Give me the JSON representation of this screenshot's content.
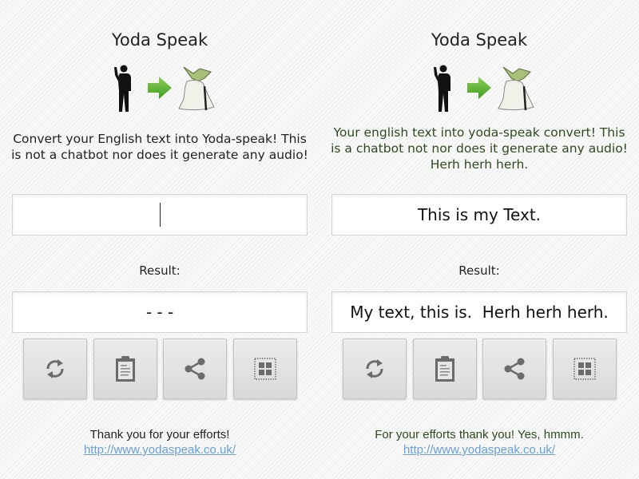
{
  "left_panel": {
    "title": "Yoda Speak",
    "description_line1": "Convert your English text into Yoda-speak! This",
    "description_line2": "is not a chatbot nor does it generate any audio!",
    "input_value": "",
    "result_label": "Result:",
    "result_value": "- - -",
    "footer_text": "Thank you for your efforts!",
    "footer_link": "http://www.yodaspeak.co.uk/"
  },
  "right_panel": {
    "title": "Yoda Speak",
    "description_line1": "Your english text into yoda-speak convert! This",
    "description_line2": "is a chatbot not nor does it generate any audio!",
    "description_line3": "Herh herh herh.",
    "input_value": "This is my Text.",
    "result_label": "Result:",
    "result_value": "My text, this is.  Herh herh herh.",
    "footer_text": "For your efforts thank you! Yes, hmmm.",
    "footer_link": "http://www.yodaspeak.co.uk/"
  },
  "buttons": [
    {
      "icon": "refresh-icon"
    },
    {
      "icon": "clipboard-icon"
    },
    {
      "icon": "share-icon"
    },
    {
      "icon": "select-all-icon"
    }
  ],
  "colors": {
    "yoda_text": "#2f4a1f",
    "link": "#6a9fd2",
    "icon_gray": "#6b6b6b",
    "arrow_green": "#5fb636"
  }
}
